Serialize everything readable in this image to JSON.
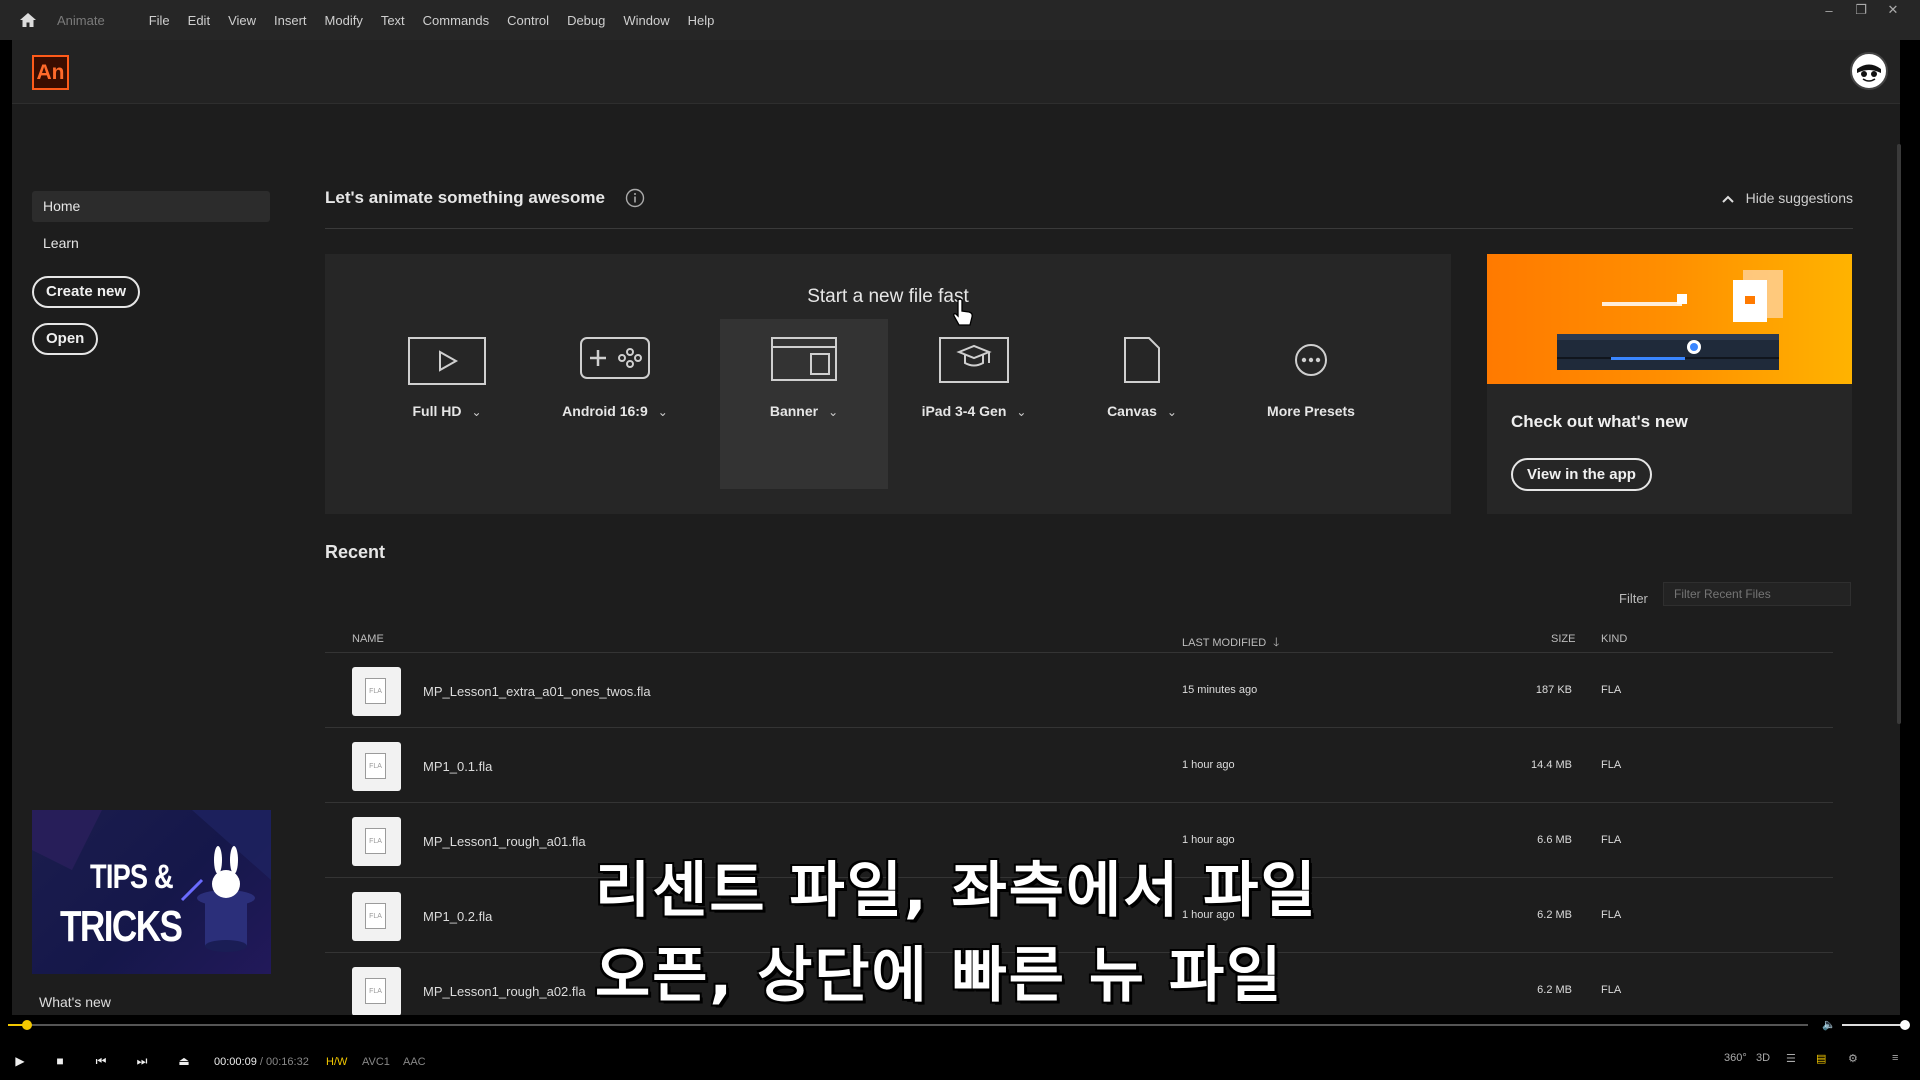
{
  "menubar": {
    "app_name": "Animate",
    "menus": [
      "File",
      "Edit",
      "View",
      "Insert",
      "Modify",
      "Text",
      "Commands",
      "Control",
      "Debug",
      "Window",
      "Help"
    ]
  },
  "app": {
    "logo_text": "An"
  },
  "sidebar": {
    "nav": [
      {
        "label": "Home",
        "active": true
      },
      {
        "label": "Learn",
        "active": false
      }
    ],
    "create_new": "Create new",
    "open": "Open",
    "tips_line1": "TIPS &",
    "tips_line2": "TRICKS",
    "whats_new": "What's new"
  },
  "main": {
    "greeting": "Let's animate something awesome",
    "hide_suggestions": "Hide suggestions",
    "presets_title": "Start a new file fast",
    "presets": [
      {
        "label": "Full HD",
        "icon": "video-play-icon",
        "selected": false
      },
      {
        "label": "Android 16:9",
        "icon": "gamepad-icon",
        "selected": false
      },
      {
        "label": "Banner",
        "icon": "browser-window-icon",
        "selected": true
      },
      {
        "label": "iPad 3-4 Gen",
        "icon": "graduation-cap-icon",
        "selected": false
      },
      {
        "label": "Canvas",
        "icon": "blank-document-icon",
        "selected": false
      },
      {
        "label": "More Presets",
        "icon": "more-dots-icon",
        "selected": false
      }
    ],
    "promo": {
      "heading": "Check out what's new",
      "button": "View in the app",
      "accent": "#ff8400"
    },
    "recent_title": "Recent",
    "filter_label": "Filter",
    "filter_placeholder": "Filter Recent Files",
    "columns": {
      "name": "NAME",
      "modified": "LAST MODIFIED",
      "size": "SIZE",
      "kind": "KIND"
    },
    "files": [
      {
        "name": "MP_Lesson1_extra_a01_ones_twos.fla",
        "modified": "15 minutes ago",
        "size": "187 KB",
        "kind": "FLA"
      },
      {
        "name": "MP1_0.1.fla",
        "modified": "1 hour ago",
        "size": "14.4 MB",
        "kind": "FLA"
      },
      {
        "name": "MP_Lesson1_rough_a01.fla",
        "modified": "1 hour ago",
        "size": "6.6 MB",
        "kind": "FLA"
      },
      {
        "name": "MP1_0.2.fla",
        "modified": "1 hour ago",
        "size": "6.2 MB",
        "kind": "FLA"
      },
      {
        "name": "MP_Lesson1_rough_a02.fla",
        "modified": "",
        "size": "6.2 MB",
        "kind": "FLA"
      }
    ],
    "file_icon_text": "FLA"
  },
  "subtitle": {
    "line1": "리센트 파일, 좌측에서 파일",
    "line2": "오픈, 상단에 빠른 뉴 파일"
  },
  "player": {
    "current_time": "00:00:09",
    "separator": "/",
    "duration": "00:16:32",
    "hw": "H/W",
    "video_codec": "AVC1",
    "audio_codec": "AAC",
    "badge_360": "360°",
    "badge_3d": "3D",
    "accent": "#f3c800"
  }
}
